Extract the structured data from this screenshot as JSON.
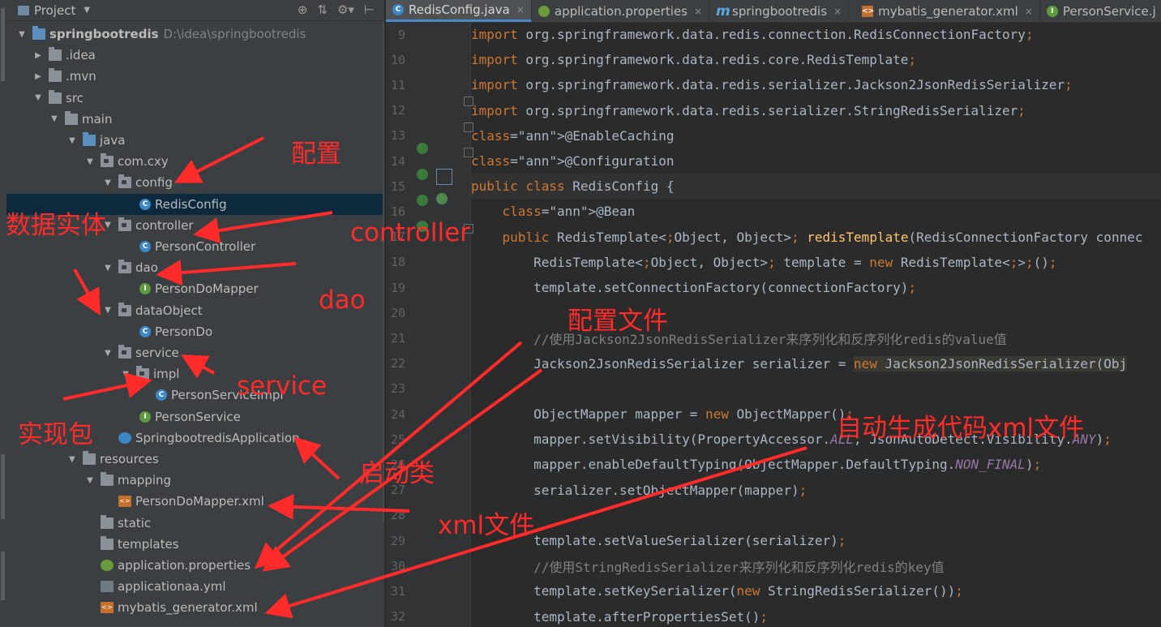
{
  "project_panel": {
    "title": "Project",
    "root_name": "springbootredis",
    "root_path": "D:\\idea\\springbootredis",
    "items": [
      {
        "label": "springbootredis",
        "expanded": "▼",
        "icon": "module-folder-icon"
      },
      {
        "label": ".idea",
        "expanded": "▶",
        "icon": "folder-icon"
      },
      {
        "label": ".mvn",
        "expanded": "▶",
        "icon": "folder-icon"
      },
      {
        "label": "src",
        "expanded": "▼",
        "icon": "folder-icon"
      },
      {
        "label": "main",
        "expanded": "▼",
        "icon": "folder-icon"
      },
      {
        "label": "java",
        "expanded": "▼",
        "icon": "source-folder-icon"
      },
      {
        "label": "com.cxy",
        "expanded": "▼",
        "icon": "package-icon"
      },
      {
        "label": "config",
        "expanded": "▼",
        "icon": "package-icon"
      },
      {
        "label": "RedisConfig",
        "expanded": "",
        "icon": "class-icon"
      },
      {
        "label": "controller",
        "expanded": "▼",
        "icon": "package-icon"
      },
      {
        "label": "PersonController",
        "expanded": "",
        "icon": "class-icon"
      },
      {
        "label": "dao",
        "expanded": "▼",
        "icon": "package-icon"
      },
      {
        "label": "PersonDoMapper",
        "expanded": "",
        "icon": "interface-icon"
      },
      {
        "label": "dataObject",
        "expanded": "▼",
        "icon": "package-icon"
      },
      {
        "label": "PersonDo",
        "expanded": "",
        "icon": "class-icon"
      },
      {
        "label": "service",
        "expanded": "▼",
        "icon": "package-icon"
      },
      {
        "label": "impl",
        "expanded": "▼",
        "icon": "package-icon"
      },
      {
        "label": "PersonServiceImpl",
        "expanded": "",
        "icon": "class-icon"
      },
      {
        "label": "PersonService",
        "expanded": "",
        "icon": "interface-icon"
      },
      {
        "label": "SpringbootredisApplication",
        "expanded": "",
        "icon": "spring-app-icon"
      },
      {
        "label": "resources",
        "expanded": "▼",
        "icon": "resources-folder-icon"
      },
      {
        "label": "mapping",
        "expanded": "▼",
        "icon": "folder-icon"
      },
      {
        "label": "PersonDoMapper.xml",
        "expanded": "",
        "icon": "xml-file-icon"
      },
      {
        "label": "static",
        "expanded": "",
        "icon": "folder-icon"
      },
      {
        "label": "templates",
        "expanded": "",
        "icon": "folder-icon"
      },
      {
        "label": "application.properties",
        "expanded": "",
        "icon": "spring-properties-icon"
      },
      {
        "label": "applicationaa.yml",
        "expanded": "",
        "icon": "yml-file-icon"
      },
      {
        "label": "mybatis_generator.xml",
        "expanded": "",
        "icon": "xml-file-icon"
      }
    ],
    "selected": "RedisConfig"
  },
  "tabs": [
    {
      "label": "RedisConfig.java",
      "icon": "class-icon",
      "active": true
    },
    {
      "label": "application.properties",
      "icon": "spring-properties-icon",
      "active": false
    },
    {
      "label": "springbootredis",
      "icon": "maven-icon",
      "active": false
    },
    {
      "label": "mybatis_generator.xml",
      "icon": "xml-file-icon",
      "active": false
    },
    {
      "label": "PersonService.j",
      "icon": "interface-icon",
      "active": false
    }
  ],
  "tab_close": "×",
  "code_lines": [
    {
      "n": "9",
      "text": "import org.springframework.data.redis.connection.RedisConnectionFactory;"
    },
    {
      "n": "10",
      "text": "import org.springframework.data.redis.core.RedisTemplate;"
    },
    {
      "n": "11",
      "text": "import org.springframework.data.redis.serializer.Jackson2JsonRedisSerializer;"
    },
    {
      "n": "12",
      "text": "import org.springframework.data.redis.serializer.StringRedisSerializer;"
    },
    {
      "n": "13",
      "text": "@EnableCaching"
    },
    {
      "n": "14",
      "text": "@Configuration"
    },
    {
      "n": "15",
      "text": "public class RedisConfig {"
    },
    {
      "n": "16",
      "text": "    @Bean"
    },
    {
      "n": "17",
      "text": "    public RedisTemplate<Object, Object> redisTemplate(RedisConnectionFactory connec"
    },
    {
      "n": "18",
      "text": "        RedisTemplate<Object, Object> template = new RedisTemplate<>();"
    },
    {
      "n": "19",
      "text": "        template.setConnectionFactory(connectionFactory);"
    },
    {
      "n": "20",
      "text": ""
    },
    {
      "n": "21",
      "text": "        //使用Jackson2JsonRedisSerializer来序列化和反序列化redis的value值"
    },
    {
      "n": "22",
      "text": "        Jackson2JsonRedisSerializer serializer = new Jackson2JsonRedisSerializer(Obj"
    },
    {
      "n": "23",
      "text": ""
    },
    {
      "n": "24",
      "text": "        ObjectMapper mapper = new ObjectMapper();"
    },
    {
      "n": "25",
      "text": "        mapper.setVisibility(PropertyAccessor.ALL, JsonAutoDetect.Visibility.ANY);"
    },
    {
      "n": "26",
      "text": "        mapper.enableDefaultTyping(ObjectMapper.DefaultTyping.NON_FINAL);"
    },
    {
      "n": "27",
      "text": "        serializer.setObjectMapper(mapper);"
    },
    {
      "n": "28",
      "text": ""
    },
    {
      "n": "29",
      "text": "        template.setValueSerializer(serializer);"
    },
    {
      "n": "30",
      "text": "        //使用StringRedisSerializer来序列化和反序列化redis的key值"
    },
    {
      "n": "31",
      "text": "        template.setKeySerializer(new StringRedisSerializer());"
    },
    {
      "n": "32",
      "text": "        template.afterPropertiesSet();"
    }
  ],
  "annotations": [
    {
      "text": "配置"
    },
    {
      "text": "数据实体"
    },
    {
      "text": "controller"
    },
    {
      "text": "dao"
    },
    {
      "text": "配置文件"
    },
    {
      "text": "service"
    },
    {
      "text": "实现包"
    },
    {
      "text": "自动生成代码xml文件"
    },
    {
      "text": "启动类"
    },
    {
      "text": "xml文件"
    }
  ],
  "colors": {
    "panel_bg": "#3c3f41",
    "editor_bg": "#2b2b2b",
    "keyword": "#cc7832",
    "annotation": "#bbb529",
    "annotation_overlay": "#ff2a2a",
    "selection": "#0d293e"
  }
}
